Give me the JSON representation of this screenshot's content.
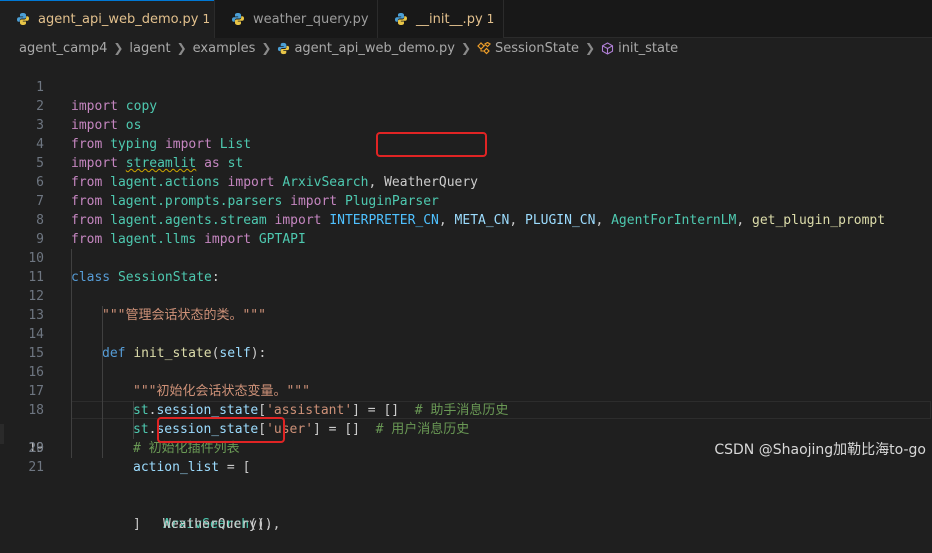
{
  "tabs": [
    {
      "name": "agent_api_web_demo.py",
      "badge": "1",
      "close": "✕",
      "active": true
    },
    {
      "name": "weather_query.py",
      "badge": "",
      "active": false
    },
    {
      "name": "__init__.py",
      "badge": "1",
      "active": false
    }
  ],
  "breadcrumb": {
    "items": [
      "agent_camp4",
      "lagent",
      "examples",
      "agent_api_web_demo.py",
      "SessionState",
      "init_state"
    ]
  },
  "line_numbers": [
    "1",
    "2",
    "3",
    "4",
    "5",
    "6",
    "7",
    "8",
    "9",
    "10",
    "11",
    "12",
    "13",
    "14",
    "15",
    "16",
    "17",
    "18",
    "19",
    "20",
    "21"
  ],
  "code": {
    "l1": [
      "import",
      " ",
      "copy"
    ],
    "l2": [
      "import",
      " ",
      "os"
    ],
    "l3": [
      "from",
      " ",
      "typing",
      " ",
      "import",
      " ",
      "List"
    ],
    "l4": [
      "import",
      " ",
      "streamlit",
      " ",
      "as",
      " ",
      "st"
    ],
    "l5": [
      "from",
      " ",
      "lagent.actions",
      " ",
      "import",
      " ",
      "ArxivSearch",
      ", ",
      "WeatherQuery"
    ],
    "l6": [
      "from",
      " ",
      "lagent.prompts.parsers",
      " ",
      "import",
      " ",
      "PluginParser"
    ],
    "l7": [
      "from",
      " ",
      "lagent.agents.stream",
      " ",
      "import",
      " ",
      "INTERPRETER_CN",
      ", ",
      "META_CN",
      ", ",
      "PLUGIN_CN",
      ", ",
      "AgentForInternLM",
      ", ",
      "get_plugin_prompt"
    ],
    "l8": [
      "from",
      " ",
      "lagent.llms",
      " ",
      "import",
      " ",
      "GPTAPI"
    ],
    "l10": [
      "class",
      " ",
      "SessionState",
      ":"
    ],
    "l11": [
      "\"\"\"管理会话状态的类。\"\"\""
    ],
    "l13": [
      "def",
      " ",
      "init_state",
      "(",
      "self",
      "):"
    ],
    "l14": [
      "\"\"\"初始化会话状态变量。\"\"\""
    ],
    "l15": [
      "st",
      ".",
      "session_state",
      "[",
      "'assistant'",
      "] = []  ",
      "# 助手消息历史"
    ],
    "l16": [
      "st",
      ".",
      "session_state",
      "[",
      "'user'",
      "] = []  ",
      "# 用户消息历史"
    ],
    "l17": [
      "# 初始化插件列表"
    ],
    "l18": [
      "action_list",
      " = ["
    ],
    "l19": [
      "ArxivSearch",
      "(),"
    ],
    "l20": [
      "WeatherQuery",
      "(),"
    ],
    "l21": [
      "]"
    ]
  },
  "watermark": "CSDN @Shaojing加勒比海to-go",
  "colors": {
    "annotation": "#e02424",
    "active_tab_accent": "#0078d4",
    "keyword": "#c586c0",
    "class": "#4ec9b0",
    "function": "#dcdcaa",
    "string": "#ce9178",
    "comment": "#6a9955"
  },
  "icons": {
    "tab": "python-file-icon",
    "breadcrumb_file": "python-file-icon",
    "breadcrumb_class": "class-symbol-icon",
    "breadcrumb_method": "method-symbol-icon",
    "separator": "chevron-right-icon"
  }
}
